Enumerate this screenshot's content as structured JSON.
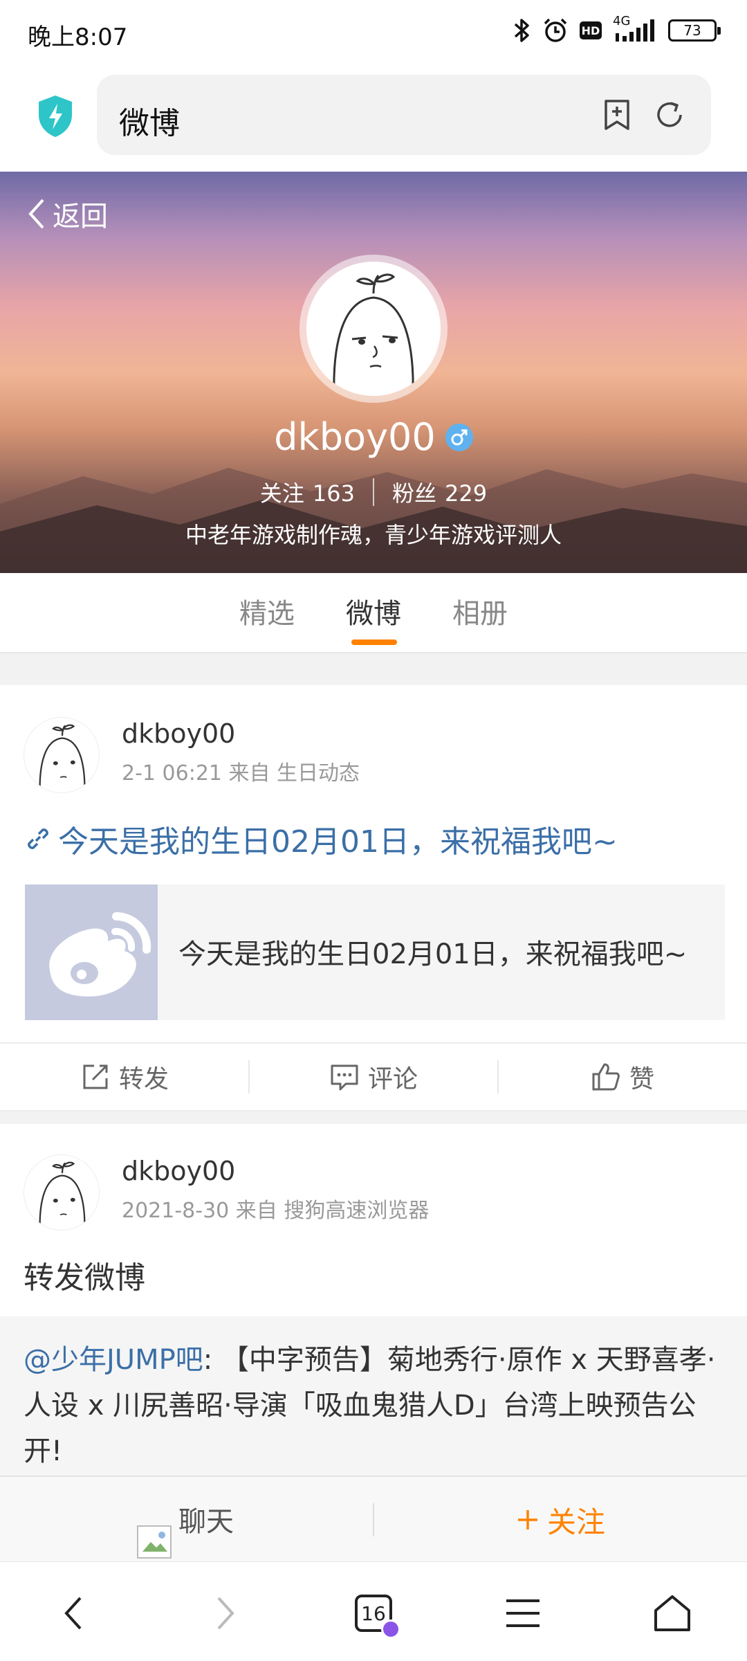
{
  "status_bar": {
    "time": "晚上8:07",
    "network": "4G",
    "hd": "HD",
    "battery": "73"
  },
  "address_bar": {
    "url_title": "微博"
  },
  "profile": {
    "back_label": "返回",
    "username": "dkboy00",
    "following_label": "关注",
    "following_count": "163",
    "followers_label": "粉丝",
    "followers_count": "229",
    "bio": "中老年游戏制作魂，青少年游戏评测人"
  },
  "tabs": [
    {
      "label": "精选",
      "active": false
    },
    {
      "label": "微博",
      "active": true
    },
    {
      "label": "相册",
      "active": false
    }
  ],
  "posts": [
    {
      "user": "dkboy00",
      "meta": "2-1 06:21 来自 生日动态",
      "link_text": "今天是我的生日02月01日，来祝福我吧~",
      "card_text": "今天是我的生日02月01日，来祝福我吧~"
    },
    {
      "user": "dkboy00",
      "meta": "2021-8-30 来自 搜狗高速浏览器",
      "text": "转发微博",
      "repost_at": "@少年JUMP吧",
      "repost_body": ": 【中字预告】菊地秀行·原作 x 天野喜孝·人设 x 川尻善昭·导演「吸血鬼猎人D」台湾上映预告公开!"
    }
  ],
  "actions": {
    "repost": "转发",
    "comment": "评论",
    "like": "赞"
  },
  "follow_bar": {
    "chat": "聊天",
    "follow": "关注"
  },
  "bottom_nav": {
    "tab_count": "16"
  },
  "icons": {
    "shield": "shield-icon",
    "bookmark": "bookmark-add-icon",
    "refresh": "refresh-icon",
    "back": "chevron-left-icon",
    "gender": "male-icon",
    "link": "link-icon",
    "repost": "share-icon",
    "comment": "comment-icon",
    "like": "thumbs-up-icon",
    "home": "home-icon",
    "menu": "menu-icon"
  },
  "colors": {
    "accent": "#ff8200",
    "link": "#3b6fa7",
    "shield": "#2ec5c8"
  }
}
